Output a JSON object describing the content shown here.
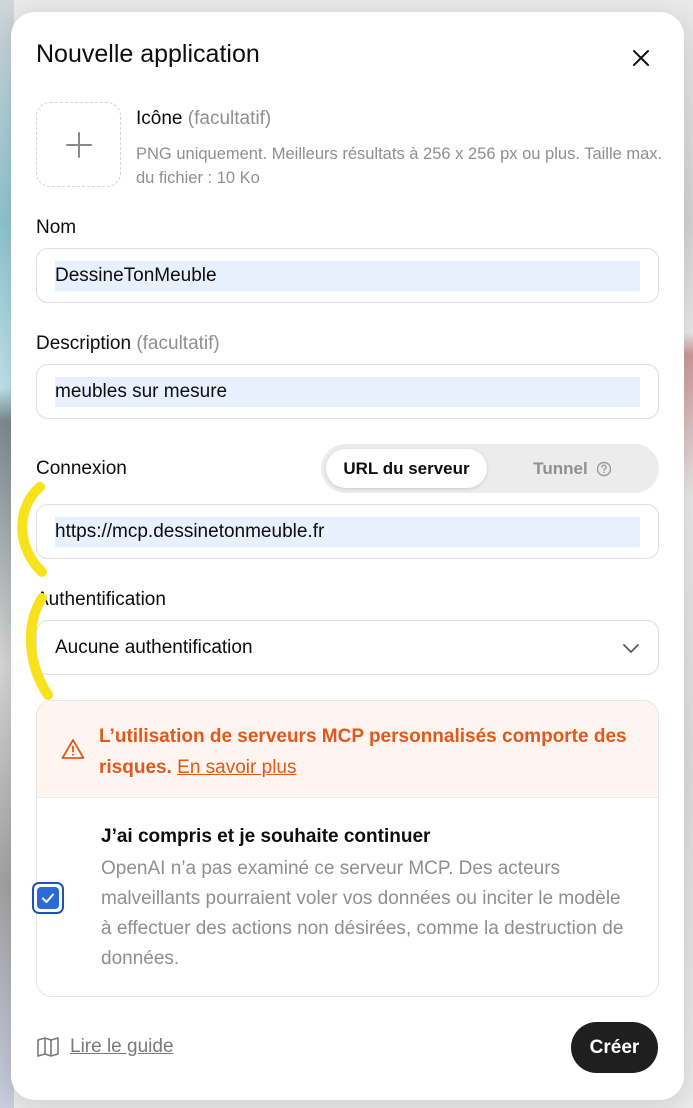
{
  "dialog": {
    "title": "Nouvelle application"
  },
  "icon_field": {
    "label": "Icône",
    "optional": "(facultatif)",
    "help": "PNG uniquement. Meilleurs résultats à 256 x 256 px ou plus. Taille max. du fichier : 10 Ko"
  },
  "name_field": {
    "label": "Nom",
    "value": "DessineTonMeuble"
  },
  "description_field": {
    "label": "Description",
    "optional": "(facultatif)",
    "value": "meubles sur mesure"
  },
  "connection": {
    "label": "Connexion",
    "tabs": [
      {
        "label": "URL du serveur",
        "active": true
      },
      {
        "label": "Tunnel",
        "active": false
      }
    ],
    "url_value": "https://mcp.dessinetonmeuble.fr"
  },
  "auth": {
    "label": "Authentification",
    "selected": "Aucune authentification"
  },
  "warning": {
    "text": "L’utilisation de serveurs MCP personnalisés comporte des risques.",
    "link": "En savoir plus",
    "color": "#e0581b"
  },
  "acknowledge": {
    "checked": true,
    "title": "J’ai compris et je souhaite continuer",
    "body": "OpenAI n’a pas examiné ce serveur MCP. Des acteurs malveillants pourraient voler vos données ou inciter le modèle à effectuer des actions non désirées, comme la destruction de données."
  },
  "footer": {
    "guide_label": "Lire le guide",
    "create_label": "Créer"
  },
  "icons": {
    "close": "close-icon",
    "add": "plus-icon",
    "help": "help-circle-icon",
    "chevron": "chevron-down-icon",
    "warning": "warning-triangle-icon",
    "check": "checkmark-icon",
    "book": "book-icon"
  }
}
